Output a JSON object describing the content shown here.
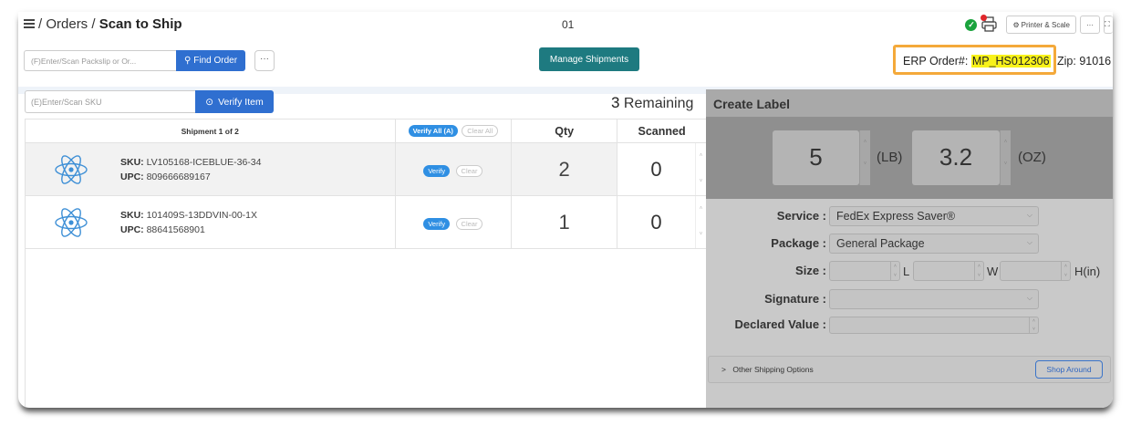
{
  "breadcrumb": {
    "sep": "/",
    "orders": "Orders",
    "current": "Scan to Ship"
  },
  "center_code": "01",
  "toolbar": {
    "printer_scale_label": "Printer & Scale",
    "more_label": "···"
  },
  "search": {
    "packslip_placeholder": "(F)Enter/Scan Packslip or Or...",
    "find_label": "Find Order",
    "more_label": "···",
    "manage_label": "Manage Shipments"
  },
  "erp": {
    "label": "ERP Order#:",
    "value": "MP_HS012306",
    "zip_label": "Zip:",
    "zip_value": "91016"
  },
  "verify": {
    "sku_placeholder": "(E)Enter/Scan SKU",
    "verify_label": "Verify Item"
  },
  "remaining": {
    "count": "3",
    "label": "Remaining"
  },
  "table": {
    "shipment_header": "Shipment 1 of 2",
    "verify_all": "Verify All (A)",
    "clear_all": "Clear All",
    "qty_header": "Qty",
    "scanned_header": "Scanned",
    "rows": [
      {
        "sku_label": "SKU:",
        "sku": "LV105168-ICEBLUE-36-34",
        "upc_label": "UPC:",
        "upc": "809666689167",
        "verify": "Verify",
        "clear": "Clear",
        "qty": "2",
        "scanned": "0"
      },
      {
        "sku_label": "SKU:",
        "sku": "101409S-13DDVIN-00-1X",
        "upc_label": "UPC:",
        "upc": "88641568901",
        "verify": "Verify",
        "clear": "Clear",
        "qty": "1",
        "scanned": "0"
      }
    ]
  },
  "label_panel": {
    "title": "Create Label",
    "lb_value": "5",
    "lb_unit": "(LB)",
    "oz_value": "3.2",
    "oz_unit": "(OZ)",
    "service_label": "Service :",
    "service_value": "FedEx Express Saver®",
    "package_label": "Package :",
    "package_value": "General Package",
    "size_label": "Size :",
    "l_unit": "L",
    "w_unit": "W",
    "h_unit": "H(in)",
    "signature_label": "Signature :",
    "declared_label": "Declared Value :",
    "other_label": "Other Shipping Options",
    "shop_label": "Shop Around"
  }
}
